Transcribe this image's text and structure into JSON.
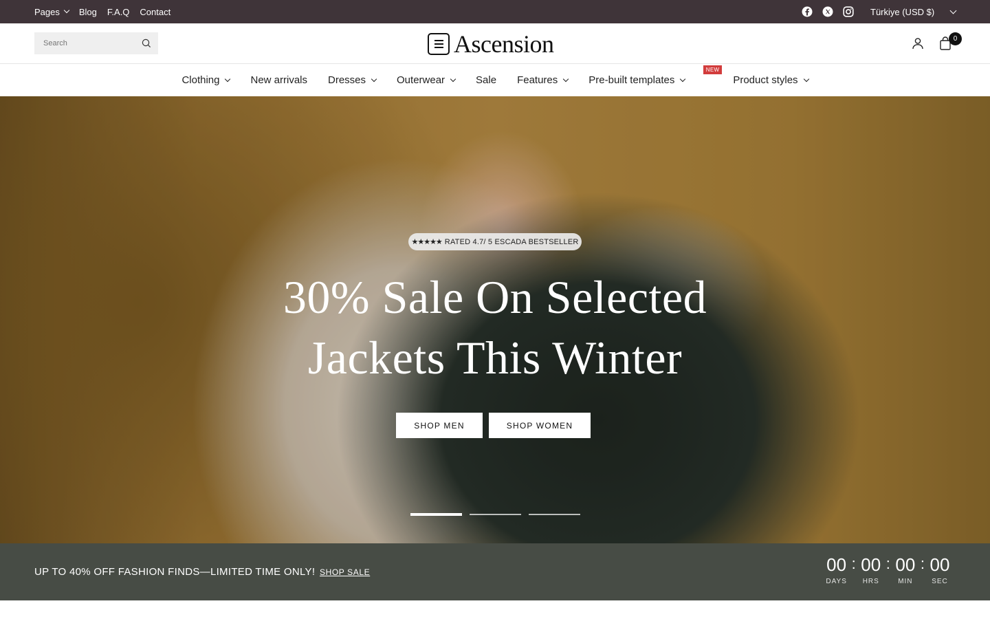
{
  "topbar": {
    "links": [
      "Pages",
      "Blog",
      "F.A.Q",
      "Contact"
    ],
    "social_icons": [
      "facebook-icon",
      "x-icon",
      "instagram-icon"
    ],
    "currency": "Türkiye (USD $)"
  },
  "header": {
    "search_placeholder": "Search",
    "logo_text": "Ascension",
    "cart_count": "0"
  },
  "nav": {
    "items": [
      "Clothing",
      "New arrivals",
      "Dresses",
      "Outerwear",
      "Sale",
      "Features",
      "Pre-built templates",
      "Product styles"
    ],
    "new_badge": "NEW"
  },
  "hero": {
    "rating_stars": "★★★★★",
    "rating_text": "RATED 4.7/ 5 ESCADA BESTSELLER",
    "title_line1": "30% Sale On Selected",
    "title_line2": "Jackets This Winter",
    "button_men": "SHOP MEN",
    "button_women": "SHOP WOMEN",
    "slides": 3,
    "active_slide": 1
  },
  "promo": {
    "message": "UP TO 40% OFF FASHION FINDS—LIMITED TIME ONLY!",
    "link": "SHOP SALE",
    "countdown": {
      "days": "00",
      "hrs": "00",
      "min": "00",
      "sec": "00",
      "labels": [
        "DAYS",
        "HRS",
        "MIN",
        "SEC"
      ]
    }
  },
  "colors": {
    "topbar_bg": "#3f3439",
    "promo_bg": "#474c45",
    "new_badge": "#d23c3c"
  }
}
